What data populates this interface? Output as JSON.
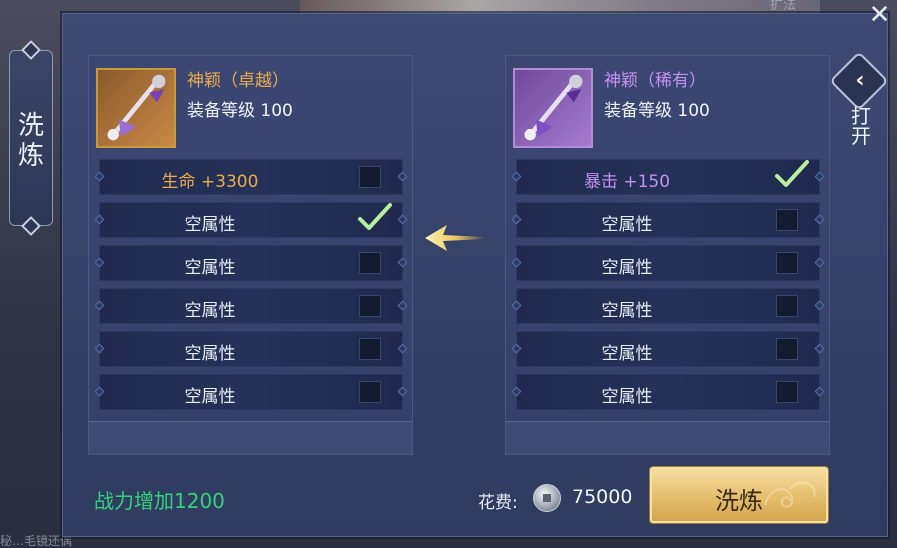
{
  "window": {
    "close_glyph": "✕"
  },
  "left_tab": {
    "label": "洗炼"
  },
  "right_tab": {
    "label": "打开",
    "icon": "chevron-left-icon"
  },
  "left_panel": {
    "item_name": "神颖（卓越）",
    "item_level": "装备等级 100",
    "name_color": "#f0a94a",
    "rows": [
      {
        "label": "生命 +3300",
        "checked": false
      },
      {
        "label": "空属性",
        "checked": true
      },
      {
        "label": "空属性",
        "checked": false
      },
      {
        "label": "空属性",
        "checked": false
      },
      {
        "label": "空属性",
        "checked": false
      },
      {
        "label": "空属性",
        "checked": false
      }
    ]
  },
  "right_panel": {
    "item_name": "神颖（稀有）",
    "item_level": "装备等级 100",
    "name_color": "#c78ff0",
    "rows": [
      {
        "label": "暴击 +150",
        "checked": true
      },
      {
        "label": "空属性",
        "checked": false
      },
      {
        "label": "空属性",
        "checked": false
      },
      {
        "label": "空属性",
        "checked": false
      },
      {
        "label": "空属性",
        "checked": false
      },
      {
        "label": "空属性",
        "checked": false
      }
    ]
  },
  "bottom": {
    "power_text": "战力增加1200",
    "cost_label": "花费:",
    "cost_value": "75000",
    "refine_button": "洗炼"
  },
  "background_text": {
    "top_right": "扩法",
    "bottom_left": "秘…毛镜还偶"
  }
}
